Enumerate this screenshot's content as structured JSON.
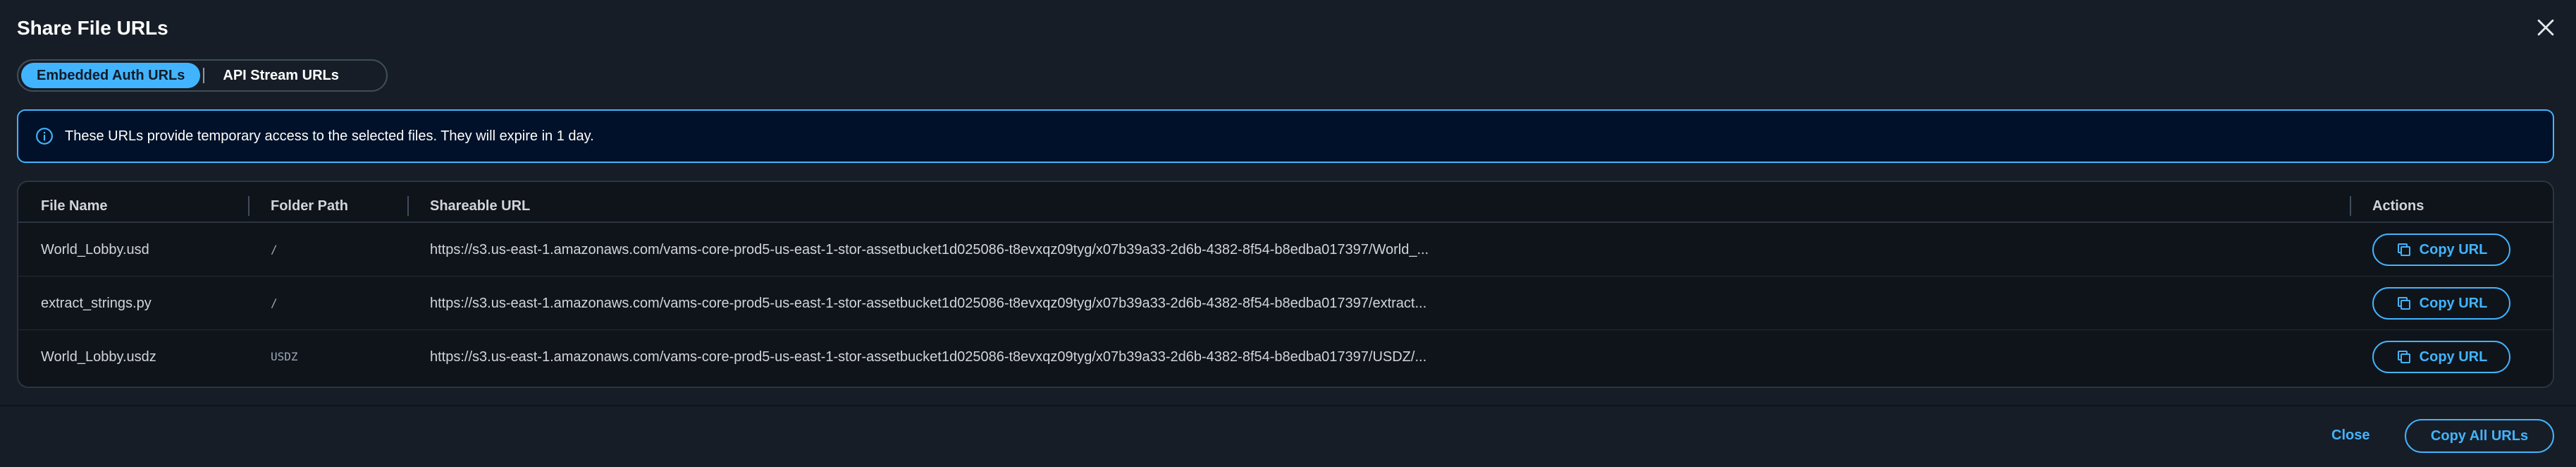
{
  "dialog": {
    "title": "Share File URLs",
    "close_icon": "close-icon"
  },
  "tabs": [
    {
      "label": "Embedded Auth URLs",
      "selected": true
    },
    {
      "label": "API Stream URLs",
      "selected": false
    }
  ],
  "alert": {
    "icon": "info-icon",
    "text": "These URLs provide temporary access to the selected files. They will expire in 1 day."
  },
  "table": {
    "columns": {
      "file_name": "File Name",
      "folder_path": "Folder Path",
      "shareable_url": "Shareable URL",
      "actions": "Actions"
    },
    "rows": [
      {
        "file_name": "World_Lobby.usd",
        "folder_path": "/",
        "url": "https://s3.us-east-1.amazonaws.com/vams-core-prod5-us-east-1-stor-assetbucket1d025086-t8evxqz09tyg/x07b39a33-2d6b-4382-8f54-b8edba017397/World_...",
        "action_label": "Copy URL"
      },
      {
        "file_name": "extract_strings.py",
        "folder_path": "/",
        "url": "https://s3.us-east-1.amazonaws.com/vams-core-prod5-us-east-1-stor-assetbucket1d025086-t8evxqz09tyg/x07b39a33-2d6b-4382-8f54-b8edba017397/extract...",
        "action_label": "Copy URL"
      },
      {
        "file_name": "World_Lobby.usdz",
        "folder_path": "USDZ",
        "url": "https://s3.us-east-1.amazonaws.com/vams-core-prod5-us-east-1-stor-assetbucket1d025086-t8evxqz09tyg/x07b39a33-2d6b-4382-8f54-b8edba017397/USDZ/...",
        "action_label": "Copy URL"
      }
    ]
  },
  "footer": {
    "close_label": "Close",
    "copy_all_label": "Copy All URLs"
  },
  "colors": {
    "background": "#161d26",
    "accent": "#42b4ff",
    "alert_background": "#001129",
    "table_background": "#0f141a"
  }
}
